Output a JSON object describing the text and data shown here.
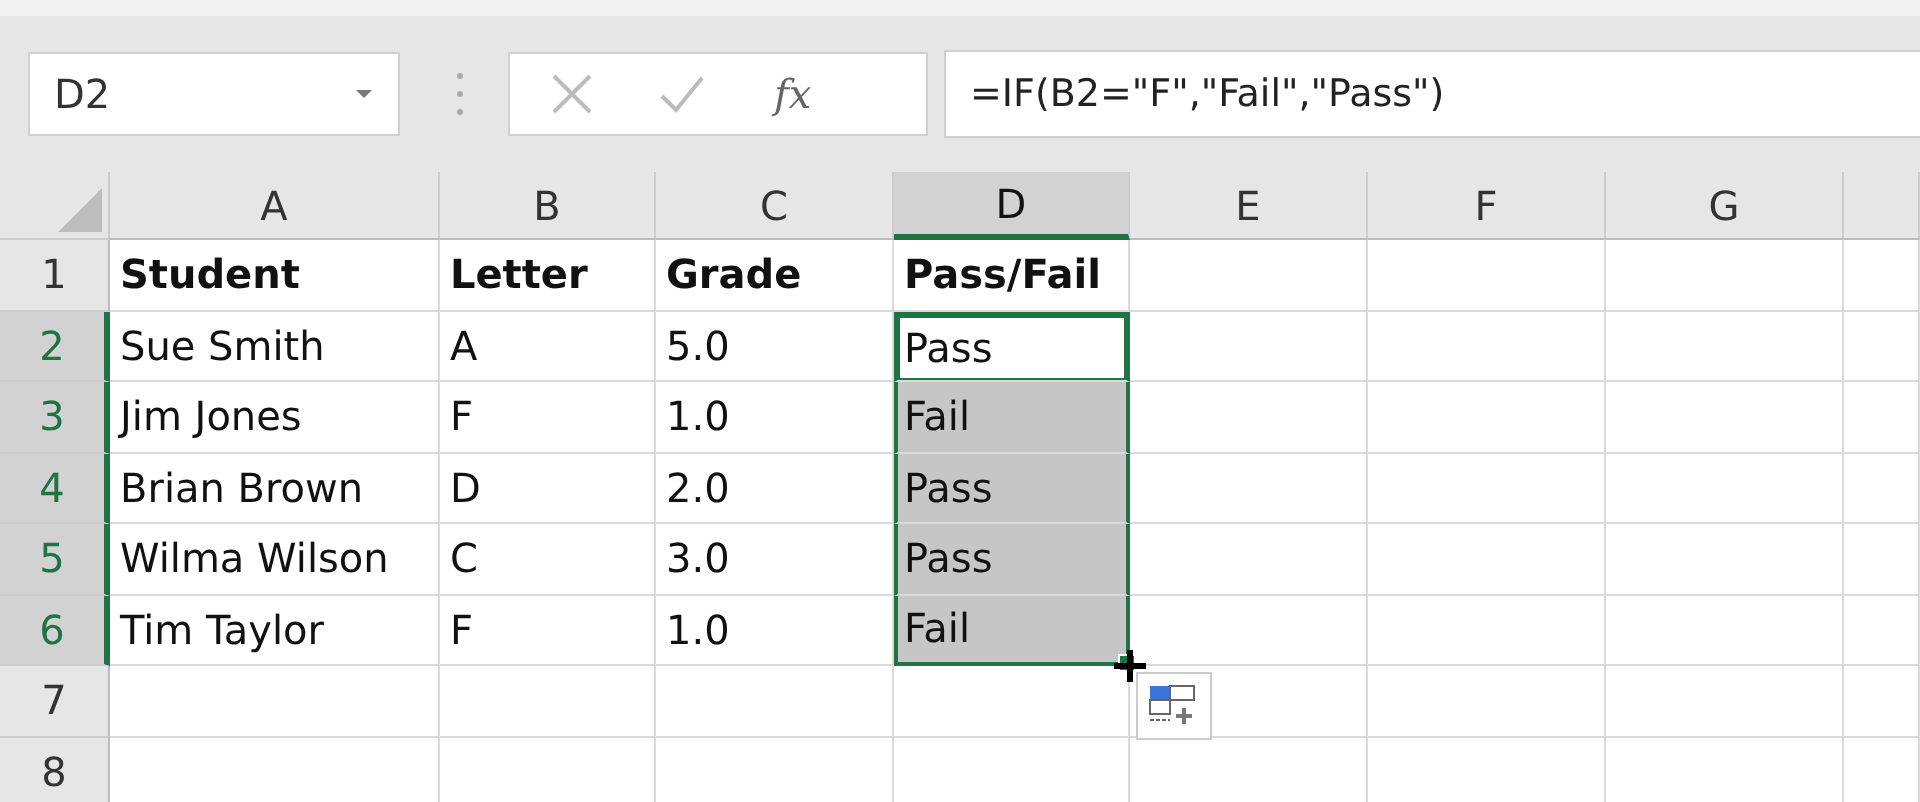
{
  "name_box": {
    "value": "D2"
  },
  "formula_bar": {
    "function_label": "fx",
    "formula": "=IF(B2=\"F\",\"Fail\",\"Pass\")"
  },
  "columns": [
    {
      "label": "A",
      "selected": false
    },
    {
      "label": "B",
      "selected": false
    },
    {
      "label": "C",
      "selected": false
    },
    {
      "label": "D",
      "selected": true
    },
    {
      "label": "E",
      "selected": false
    },
    {
      "label": "F",
      "selected": false
    },
    {
      "label": "G",
      "selected": false
    }
  ],
  "rows": [
    {
      "number": "1",
      "kind": "header",
      "selected": false,
      "cells": [
        {
          "text": "Student",
          "selected": false
        },
        {
          "text": "Letter",
          "selected": false
        },
        {
          "text": "Grade",
          "selected": false
        },
        {
          "text": "Pass/Fail",
          "selected": false
        }
      ]
    },
    {
      "number": "2",
      "kind": "data",
      "selected": true,
      "cells": [
        {
          "text": "Sue Smith",
          "selected": false
        },
        {
          "text": "A",
          "selected": false
        },
        {
          "text": "5.0",
          "selected": false
        },
        {
          "text": "Pass",
          "selected": true,
          "active": true
        }
      ]
    },
    {
      "number": "3",
      "kind": "data",
      "selected": true,
      "cells": [
        {
          "text": "Jim Jones",
          "selected": false
        },
        {
          "text": "F",
          "selected": false
        },
        {
          "text": "1.0",
          "selected": false
        },
        {
          "text": "Fail",
          "selected": true,
          "active": false
        }
      ]
    },
    {
      "number": "4",
      "kind": "data",
      "selected": true,
      "cells": [
        {
          "text": "Brian Brown",
          "selected": false
        },
        {
          "text": "D",
          "selected": false
        },
        {
          "text": "2.0",
          "selected": false
        },
        {
          "text": "Pass",
          "selected": true,
          "active": false
        }
      ]
    },
    {
      "number": "5",
      "kind": "data",
      "selected": true,
      "cells": [
        {
          "text": "Wilma Wilson",
          "selected": false
        },
        {
          "text": "C",
          "selected": false
        },
        {
          "text": "3.0",
          "selected": false
        },
        {
          "text": "Pass",
          "selected": true,
          "active": false
        }
      ]
    },
    {
      "number": "6",
      "kind": "data",
      "selected": true,
      "cells": [
        {
          "text": "Tim Taylor",
          "selected": false
        },
        {
          "text": "F",
          "selected": false
        },
        {
          "text": "1.0",
          "selected": false
        },
        {
          "text": "Fail",
          "selected": true,
          "active": false
        }
      ]
    },
    {
      "number": "7",
      "kind": "data",
      "selected": false,
      "cells": []
    },
    {
      "number": "8",
      "kind": "data",
      "selected": false,
      "cells": []
    }
  ]
}
